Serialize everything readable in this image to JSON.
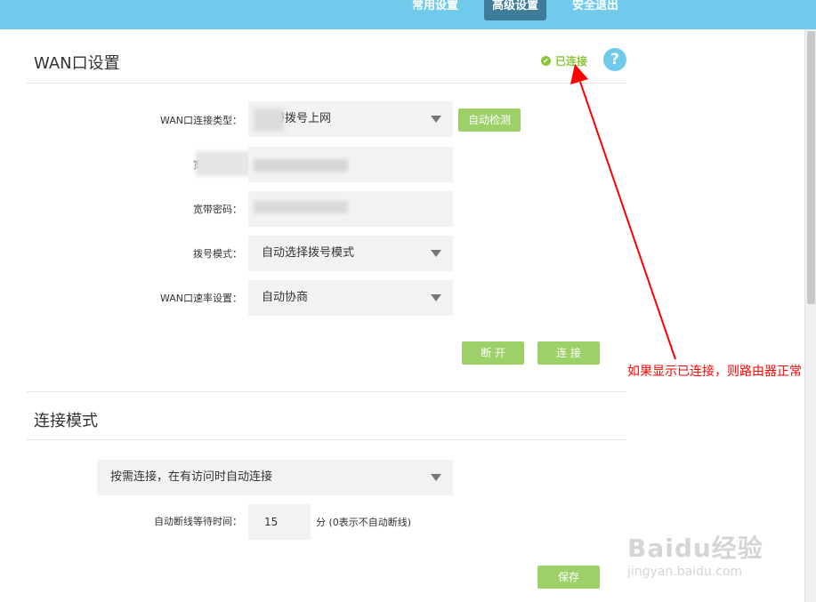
{
  "nav": {
    "tabs": [
      {
        "label": "常用设置",
        "active": false
      },
      {
        "label": "高级设置",
        "active": true
      },
      {
        "label": "安全退出",
        "active": false
      }
    ]
  },
  "wan": {
    "title": "WAN口设置",
    "status": "已连接",
    "help_label": "?",
    "connection_type_label": "WAN口连接类型：",
    "connection_type_value": "宽带拨号上网",
    "auto_detect_label": "自动检测",
    "account_label": "宽带账号：",
    "password_label": "宽带密码：",
    "dial_mode_label": "拨号模式：",
    "dial_mode_value": "自动选择拨号模式",
    "speed_label": "WAN口速率设置：",
    "speed_value": "自动协商",
    "disconnect_label": "断 开",
    "connect_label": "连 接"
  },
  "conn_mode": {
    "title": "连接模式",
    "mode_value": "按需连接，在有访问时自动连接",
    "idle_label": "自动断线等待时间：",
    "idle_value": "15",
    "idle_unit": "分 (0表示不自动断线)",
    "save_label": "保存"
  },
  "annotation": {
    "text": "如果显示已连接，则路由器正常",
    "color": "#ff0000"
  },
  "watermark": {
    "main": "Baidu经验",
    "sub": "jingyan.baidu.com"
  },
  "colors": {
    "topbar": "#6fcaec",
    "button": "#9ed06a",
    "status": "#8cc63f"
  }
}
